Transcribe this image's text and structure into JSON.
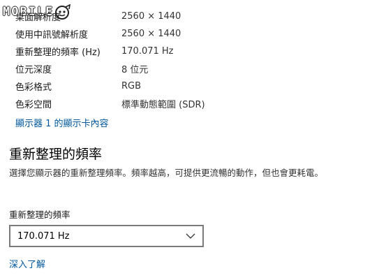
{
  "watermark": {
    "text": "MOBILE"
  },
  "info": [
    {
      "label": "桌面解析度",
      "value": "2560 × 1440"
    },
    {
      "label": "使用中訊號解析度",
      "value": "2560 × 1440"
    },
    {
      "label": "重新整理的頻率 (Hz)",
      "value": "170.071 Hz"
    },
    {
      "label": "位元深度",
      "value": "8 位元"
    },
    {
      "label": "色彩格式",
      "value": "RGB"
    },
    {
      "label": "色彩空間",
      "value": "標準動態範圍 (SDR)"
    }
  ],
  "adapter_link": "顯示器 1 的顯示卡內容",
  "refresh": {
    "title": "重新整理的頻率",
    "description": "選擇您顯示器的重新整理頻率。頻率越高，可提供更流暢的動作，但也會更耗電。",
    "field_label": "重新整理的頻率",
    "selected": "170.071 Hz",
    "learn_more": "深入了解"
  }
}
